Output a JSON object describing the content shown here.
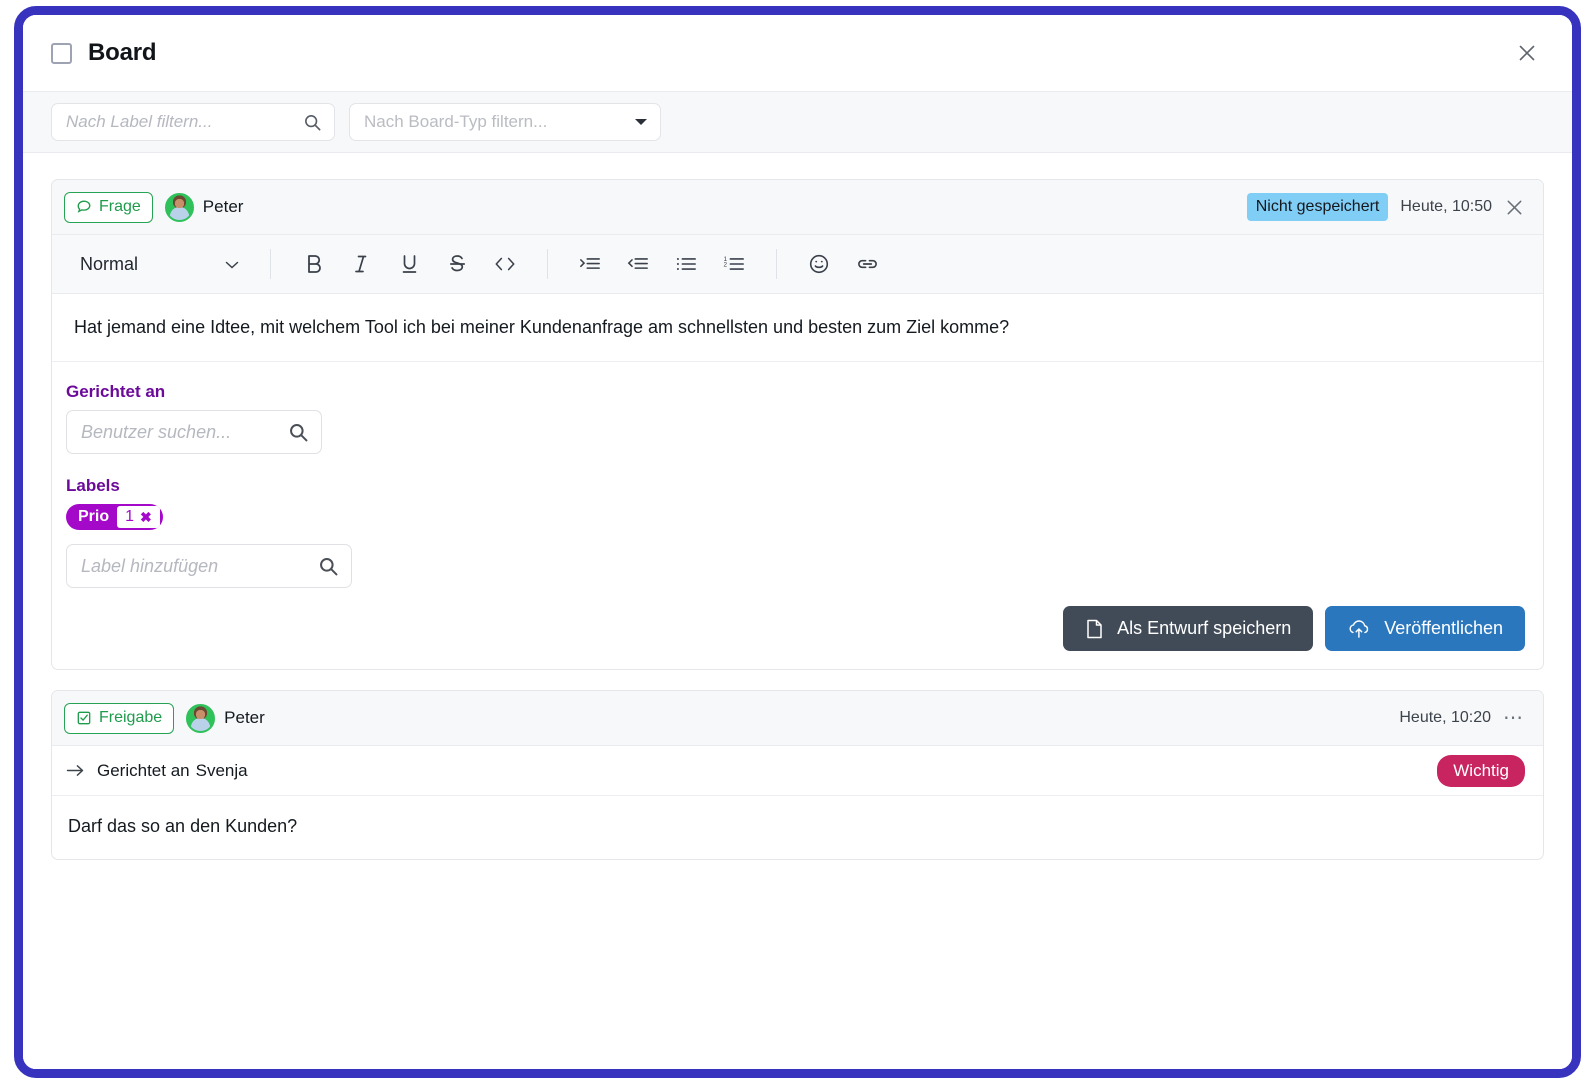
{
  "window": {
    "title": "Board",
    "board_checkbox_icon": "square-icon",
    "close_icon": "close-icon"
  },
  "filters": {
    "label_filter_placeholder": "Nach Label filtern...",
    "label_filter_value": "",
    "label_filter_icon": "search-icon",
    "board_type_placeholder": "Nach Board-Typ filtern...",
    "board_type_value": "",
    "board_type_icon": "chevron-down-icon"
  },
  "colors": {
    "window_border": "#3733bf",
    "accent_purple": "#6c0a99",
    "chip_purple": "#a409c9",
    "badge_green": "#1f9b4c",
    "status_blue": "#80cdf5",
    "important_red": "#c8245f",
    "publish_blue": "#2a77bd",
    "draft_slate": "#414b57",
    "avatar_ring_green": "#2fc15a"
  },
  "cards": [
    {
      "type_badge": {
        "label": "Frage",
        "icon": "speech-bubble-icon"
      },
      "author": "Peter",
      "avatar_icon": "avatar",
      "status": "Nicht gespeichert",
      "timestamp": "Heute, 10:50",
      "close_icon": "close-icon",
      "editor": {
        "style_value": "Normal",
        "style_caret_icon": "chevron-down-icon",
        "tools": [
          {
            "name": "bold-button",
            "icon": "bold-icon",
            "glyph": "B"
          },
          {
            "name": "italic-button",
            "icon": "italic-icon",
            "glyph": "I"
          },
          {
            "name": "underline-button",
            "icon": "underline-icon",
            "glyph": "U"
          },
          {
            "name": "strikethrough-button",
            "icon": "strikethrough-icon",
            "glyph": "S"
          },
          {
            "name": "code-button",
            "icon": "code-icon",
            "glyph": "<>"
          },
          {
            "name": "indent-button",
            "icon": "indent-increase-icon",
            "glyph": ">"
          },
          {
            "name": "outdent-button",
            "icon": "indent-decrease-icon",
            "glyph": "<"
          },
          {
            "name": "bullet-list-button",
            "icon": "bullet-list-icon",
            "glyph": ""
          },
          {
            "name": "numbered-list-button",
            "icon": "numbered-list-icon",
            "glyph": ""
          },
          {
            "name": "emoji-button",
            "icon": "smiley-icon",
            "glyph": ""
          },
          {
            "name": "link-button",
            "icon": "link-icon",
            "glyph": ""
          }
        ],
        "content": "Hat jemand eine Idtee, mit welchem Tool ich bei meiner Kundenanfrage am schnellsten und besten zum Ziel komme?"
      },
      "recipients_section": {
        "label": "Gerichtet an",
        "search_placeholder": "Benutzer suchen...",
        "search_value": "",
        "search_icon": "search-icon"
      },
      "labels_section": {
        "label": "Labels",
        "chips": [
          {
            "name": "Prio",
            "value": "1",
            "remove_icon": "close-icon"
          }
        ],
        "add_placeholder": "Label hinzufügen",
        "add_value": "",
        "add_icon": "search-icon"
      },
      "actions": {
        "draft_label": "Als Entwurf speichern",
        "draft_icon": "document-icon",
        "publish_label": "Veröffentlichen",
        "publish_icon": "cloud-upload-icon"
      }
    },
    {
      "type_badge": {
        "label": "Freigabe",
        "icon": "approval-checkbox-icon"
      },
      "author": "Peter",
      "avatar_icon": "avatar",
      "timestamp": "Heute, 10:20",
      "more_icon": "more-horizontal-icon",
      "recipient": {
        "arrow_icon": "arrow-right-icon",
        "prefix": "Gerichtet an",
        "name": "Svenja"
      },
      "importance_badge": "Wichtig",
      "body": "Darf das so an den Kunden?"
    }
  ]
}
